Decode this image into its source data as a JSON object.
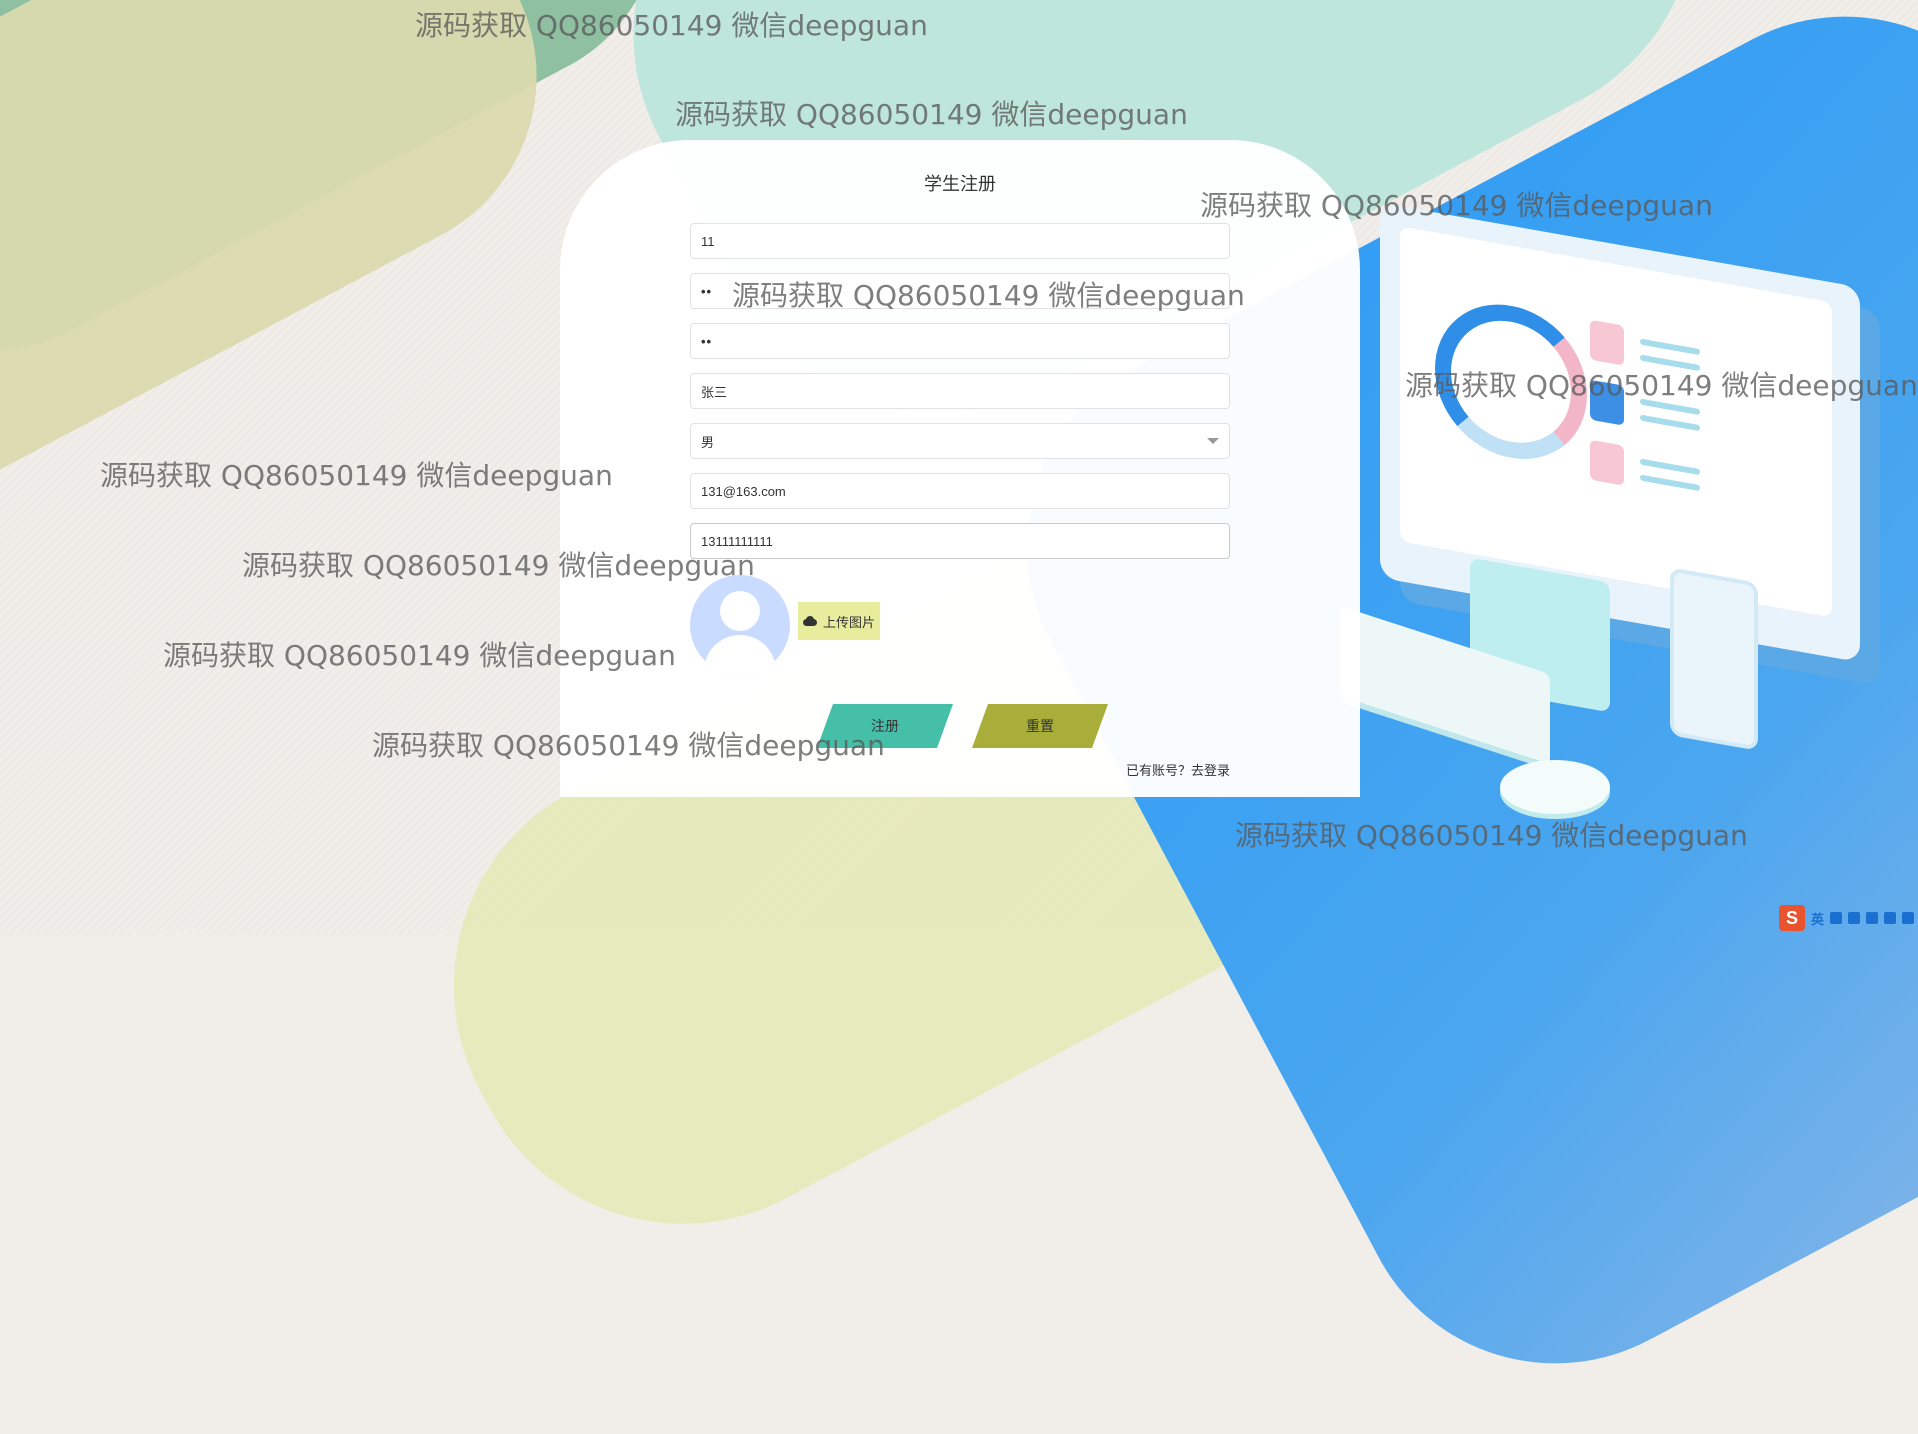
{
  "form": {
    "title": "学生注册",
    "account_value": "11",
    "password_value": "••",
    "confirm_password_value": "••",
    "name_value": "张三",
    "gender_selected": "男",
    "email_value": "131@163.com",
    "phone_value": "13111111111",
    "upload_label": "上传图片",
    "register_label": "注册",
    "reset_label": "重置",
    "login_prompt": "已有账号？",
    "login_link": "去登录"
  },
  "watermark": "源码获取 QQ86050149 微信deepguan",
  "ime": {
    "logo": "S",
    "lang": "英",
    "icons": [
      "punctuation-icon",
      "mic-icon",
      "keyboard-icon",
      "skin-icon",
      "toolbox-icon"
    ]
  },
  "colors": {
    "register_button": "#45bfa8",
    "reset_button": "#a9ae3a",
    "upload_button": "#e7ed9d",
    "avatar_bg": "#c9dbff"
  }
}
